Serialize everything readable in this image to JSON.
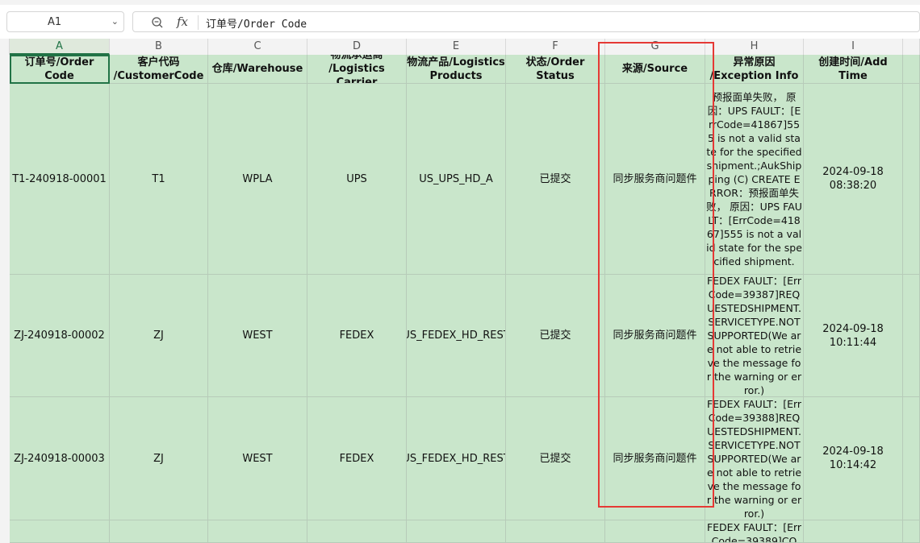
{
  "name_box": {
    "ref": "A1"
  },
  "formula_bar": {
    "fx_label": "fx",
    "content": "订单号/Order Code"
  },
  "columns": [
    "",
    "A",
    "B",
    "C",
    "D",
    "E",
    "F",
    "G",
    "H",
    "I"
  ],
  "headers": [
    "订单号/Order Code",
    "客户代码 /CustomerCode",
    "仓库/Warehouse",
    "物流承运商 /Logistics Carrier",
    "物流产品/Logistics Products",
    "状态/Order Status",
    "来源/Source",
    "异常原因 /Exception Info",
    "创建时间/Add Time"
  ],
  "rows": [
    {
      "order_code": "T1-240918-00001",
      "customer_code": "T1",
      "warehouse": "WPLA",
      "carrier": "UPS",
      "product": "US_UPS_HD_A",
      "status": "已提交",
      "source": "同步服务商问题件",
      "exception": "预报面单失败， 原因：UPS FAULT：[ErrCode=41867]555 is not a valid state for the specified shipment.;AukShipping (C) CREATE ERROR：预报面单失败， 原因：UPS FAULT：[ErrCode=41867]555 is not a valid state for the specified shipment.",
      "add_time": "2024-09-18 08:38:20"
    },
    {
      "order_code": "ZJ-240918-00002",
      "customer_code": "ZJ",
      "warehouse": "WEST",
      "carrier": "FEDEX",
      "product": "US_FEDEX_HD_REST",
      "status": "已提交",
      "source": "同步服务商问题件",
      "exception": "FEDEX FAULT：[ErrCode=39387]REQUESTEDSHIPMENT.SERVICETYPE.NOTSUPPORTED(We are not able to retrieve the message for the warning or error.)",
      "add_time": "2024-09-18 10:11:44"
    },
    {
      "order_code": "ZJ-240918-00003",
      "customer_code": "ZJ",
      "warehouse": "WEST",
      "carrier": "FEDEX",
      "product": "US_FEDEX_HD_REST",
      "status": "已提交",
      "source": "同步服务商问题件",
      "exception": "FEDEX FAULT：[ErrCode=39388]REQUESTEDSHIPMENT.SERVICETYPE.NOTSUPPORTED(We are not able to retrieve the message for the warning or error.)",
      "add_time": "2024-09-18 10:14:42"
    },
    {
      "order_code": "",
      "customer_code": "",
      "warehouse": "",
      "carrier": "",
      "product": "",
      "status": "",
      "source": "",
      "exception": "FEDEX FAULT：[ErrCode=39389]CO",
      "add_time": ""
    }
  ],
  "colors": {
    "grid_fill": "#c9e6cb",
    "highlight_box": "#e53935",
    "active_cell": "#217346"
  }
}
